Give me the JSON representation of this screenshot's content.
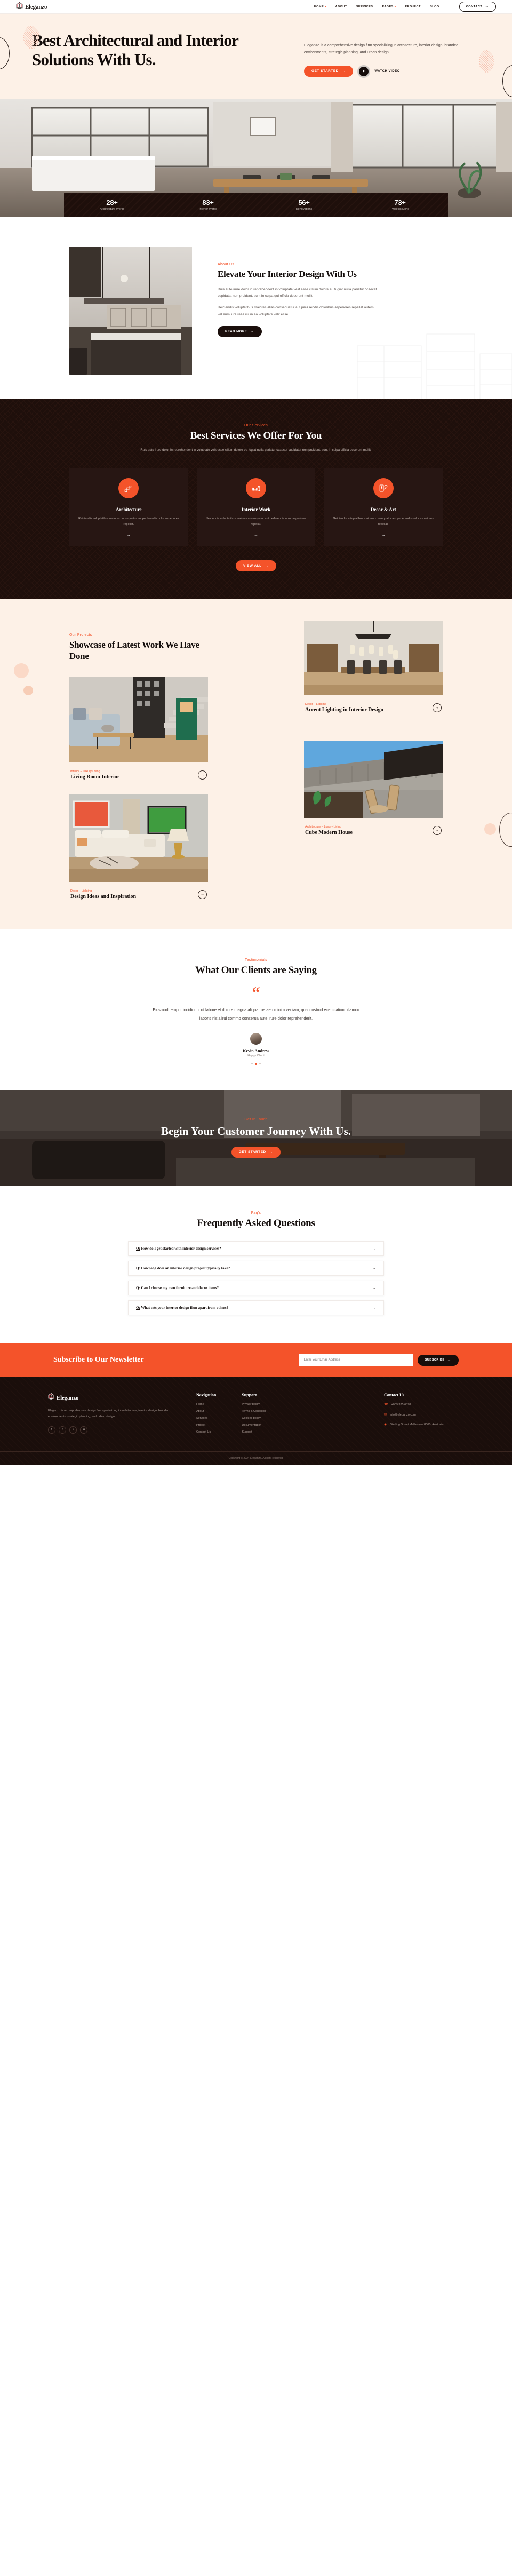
{
  "brand": {
    "name": "Eleganzo",
    "logo_icon": "house-logo-icon"
  },
  "nav": {
    "items": [
      {
        "label": "HOME",
        "has_dropdown": true
      },
      {
        "label": "ABOUT",
        "has_dropdown": false
      },
      {
        "label": "SERVICES",
        "has_dropdown": false
      },
      {
        "label": "PAGES",
        "has_dropdown": true
      },
      {
        "label": "PROJECT",
        "has_dropdown": false
      },
      {
        "label": "BLOG",
        "has_dropdown": false
      }
    ],
    "contact_label": "CONTACT"
  },
  "hero": {
    "title": "Best Architectural and Interior Solutions With Us.",
    "description": "Eleganzo is a comprehensive design firm specializing in architecture, interior design, branded environments, strategic planning, and urban design.",
    "primary_cta": "GET STARTED",
    "video_label": "WATCH VIDEO"
  },
  "stats": [
    {
      "value": "28+",
      "label": "Architecture Works"
    },
    {
      "value": "83+",
      "label": "Interior Works"
    },
    {
      "value": "56+",
      "label": "Renovations"
    },
    {
      "value": "73+",
      "label": "Projects Done"
    }
  ],
  "about": {
    "eyebrow": "About Us",
    "title": "Elevate Your Interior Design With Us",
    "paragraph1": "Duis aute irure dolor in reprehenderit in voluptate velit esse cillum dolore eu fugiat nulla pariatur ccaecat cupidatat non proident, sunt in culpa qui officia deserunt mollit.",
    "paragraph2": "Reiciendis voluptatibus maiores alias consequatur aut pera rendis doloribus asperiores repellat autem vel eum iure reae rui in ea voluptate velit esse.",
    "cta": "READ MORE"
  },
  "services": {
    "eyebrow": "Our Services",
    "title": "Best Services We Offer For You",
    "description": "Ruis aute irure dolor in reprehenderit in voluptate velit esse cilium dolore eu fugiat nulla pariatur ccaecat cupidatat non proident, sunt in culpa officia deserunt mollit.",
    "cards": [
      {
        "icon": "stairs-icon",
        "title": "Architecture",
        "text": "Reiciendis voluptatibus maiores consequatur aut perferendis nolor asperiores repellat."
      },
      {
        "icon": "armchair-lamp-icon",
        "title": "Interior Work",
        "text": "Neiciendis voluptatibus maiores consequatur aut perferendis nolor asperiores repellat."
      },
      {
        "icon": "paint-roller-icon",
        "title": "Decor & Art",
        "text": "Geiciendis voluptatibus maiores consequatur aut perferendis nolor asperiores repellat."
      }
    ],
    "view_all": "VIEW ALL"
  },
  "projects": {
    "eyebrow": "Our Projects",
    "title": "Showcase of Latest Work We Have Done",
    "items": [
      {
        "category": "Decor – Lighting",
        "title": "Accent Lighting in Interior Design"
      },
      {
        "category": "Interior – Luxury Living",
        "title": "Living Room Interior"
      },
      {
        "category": "Architecture – Luxury Living",
        "title": "Cube Modern House"
      },
      {
        "category": "Decor – Lighting",
        "title": "Design Ideas and Inspiration"
      }
    ]
  },
  "testimonials": {
    "eyebrow": "Testimonials",
    "title": "What Our Clients are Saying",
    "quote_icon": "quote-icon",
    "quote": "Eiusmod tempor incididunt ut labore et dolore magna aliqua rue aeu minim veniam, quis nostrud exercitation ullamco laboris nisialirui commo conserua aute irure dolor reprehenderit.",
    "author_name": "Kevin Andrew",
    "author_role": "Happy Client",
    "dots_total": 3,
    "dot_active_index": 1
  },
  "cta_banner": {
    "eyebrow": "Get In Touch",
    "title": "Begin Your Customer Journey With Us.",
    "button": "GET STARTED"
  },
  "faq": {
    "eyebrow": "Faq's",
    "title": "Frequently Asked Questions",
    "items": [
      {
        "prefix": "Q:",
        "question": "How do I get started with interior design services?"
      },
      {
        "prefix": "Q:",
        "question": "How long does an interior design project typically take?"
      },
      {
        "prefix": "Q:",
        "question": "Can I choose my own furniture and decor items?"
      },
      {
        "prefix": "Q:",
        "question": "What sets your interior design firm apart from others?"
      }
    ]
  },
  "newsletter": {
    "title": "Subscribe to Our Newsletter",
    "placeholder": "Enter Your Email Address",
    "button": "SUBSCRIBE"
  },
  "footer": {
    "about": "Eleganzo is a comprehensive design firm specializing in architecture, interior design, branded environments, strategic planning, and urban design.",
    "social": [
      {
        "icon": "facebook-icon",
        "glyph": "f"
      },
      {
        "icon": "twitter-icon",
        "glyph": "t"
      },
      {
        "icon": "instagram-icon",
        "glyph": "i"
      },
      {
        "icon": "linkedin-icon",
        "glyph": "in"
      }
    ],
    "columns": [
      {
        "heading": "Navigation",
        "links": [
          "Home",
          "About",
          "Services",
          "Project",
          "Contact Us"
        ]
      },
      {
        "heading": "Support",
        "links": [
          "Privacy policy",
          "Terms & Condition",
          "Cookies policy",
          "Documentation",
          "Support"
        ]
      }
    ],
    "contact_heading": "Contact Us",
    "contact": [
      {
        "icon": "phone-icon",
        "glyph": "☎",
        "text": "+009 325 6598"
      },
      {
        "icon": "mail-icon",
        "glyph": "✉",
        "text": "info@eleganzo.com"
      },
      {
        "icon": "location-icon",
        "glyph": "◉",
        "text": "Sterling Street Melbourne 8000, Australia"
      }
    ],
    "copyright": "Copyright © 2024 Eleganzo. All right reserved."
  },
  "colors": {
    "accent": "#f4532a",
    "dark": "#1e0f0b",
    "cream": "#fdf1e7"
  }
}
